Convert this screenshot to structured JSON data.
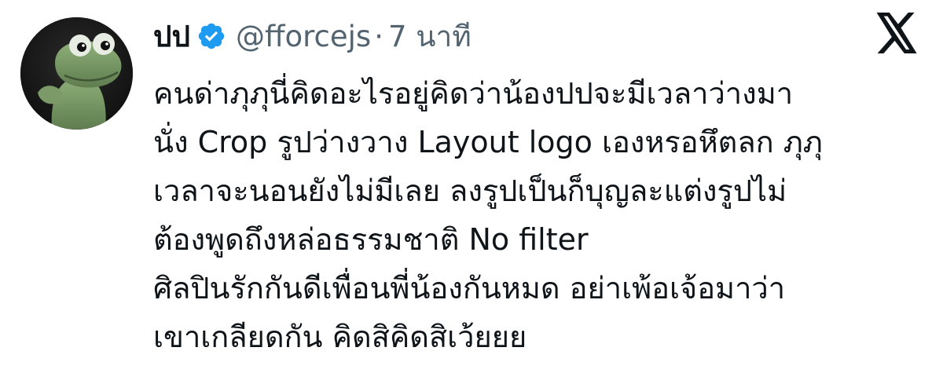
{
  "tweet": {
    "display_name": "ปป",
    "handle": "@fforcejs",
    "separator": "·",
    "time": "7 นาที",
    "lines": [
      "คนด่าภุภุนี่คิดอะไรอยู่คิดว่าน้องปปจะมีเวลาว่างมา",
      "นั่ง Crop รูปว่างวาง Layout logo เองหรอหึตลก ภุภุ",
      "เวลาจะนอนยังไม่มีเลย ลงรูปเป็นก็บุญละแต่งรูปไม่",
      "ต้องพูดถึงหล่อธรรมชาติ No filter",
      "ศิลปินรักกันดีเพื่อนพี่น้องกันหมด อย่าเพ้อเจ้อมาว่า",
      "เขาเกลียดกัน คิดสิคิดสิเว้ยยย"
    ]
  },
  "icons": {
    "avatar": "frog-avatar",
    "verified": "verified-badge-icon",
    "platform": "x-logo-icon"
  },
  "colors": {
    "text": "#0f1419",
    "secondary": "#536471",
    "verified": "#1d9bf0"
  }
}
